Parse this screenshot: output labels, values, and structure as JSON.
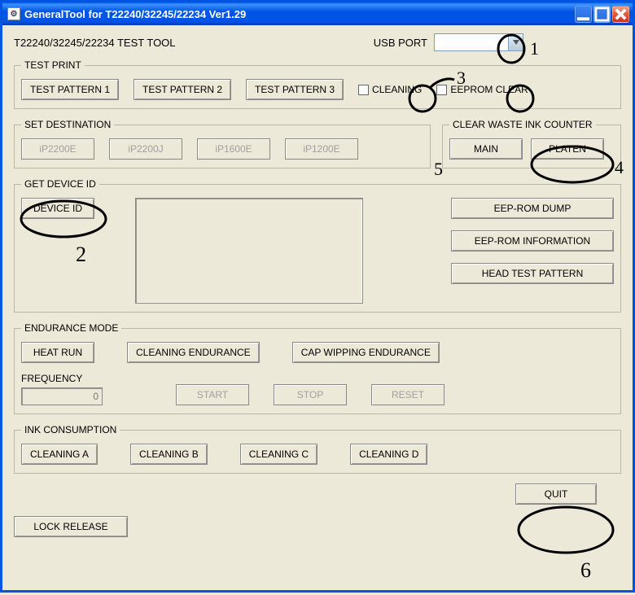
{
  "window": {
    "title": "GeneralTool for T22240/32245/22234 Ver1.29",
    "tool_label": "T22240/32245/22234 TEST TOOL",
    "usb_label": "USB PORT"
  },
  "test_print": {
    "legend": "TEST PRINT",
    "pattern1": "TEST PATTERN 1",
    "pattern2": "TEST PATTERN 2",
    "pattern3": "TEST PATTERN 3",
    "cleaning": "CLEANING",
    "eeprom_clear": "EEPROM CLEAR"
  },
  "set_dest": {
    "legend": "SET DESTINATION",
    "btns": [
      "iP2200E",
      "iP2200J",
      "iP1600E",
      "iP1200E"
    ]
  },
  "waste": {
    "legend": "CLEAR WASTE INK COUNTER",
    "main": "MAIN",
    "platen": "PLATEN"
  },
  "get_device": {
    "legend": "GET DEVICE ID",
    "device_id": "DEVICE ID",
    "eep_dump": "EEP-ROM DUMP",
    "eep_info": "EEP-ROM INFORMATION",
    "head_test": "HEAD TEST PATTERN"
  },
  "endure": {
    "legend": "ENDURANCE MODE",
    "heat_run": "HEAT RUN",
    "cleaning_endure": "CLEANING ENDURANCE",
    "cap_wipe": "CAP WIPPING ENDURANCE",
    "freq_label": "FREQUENCY",
    "freq_value": "0",
    "start": "START",
    "stop": "STOP",
    "reset": "RESET"
  },
  "ink": {
    "legend": "INK CONSUMPTION",
    "a": "CLEANING A",
    "b": "CLEANING B",
    "c": "CLEANING C",
    "d": "CLEANING D"
  },
  "footer": {
    "quit": "QUIT",
    "lock_release": "LOCK RELEASE"
  },
  "annotations": [
    "1",
    "2",
    "3",
    "4",
    "5",
    "6"
  ]
}
